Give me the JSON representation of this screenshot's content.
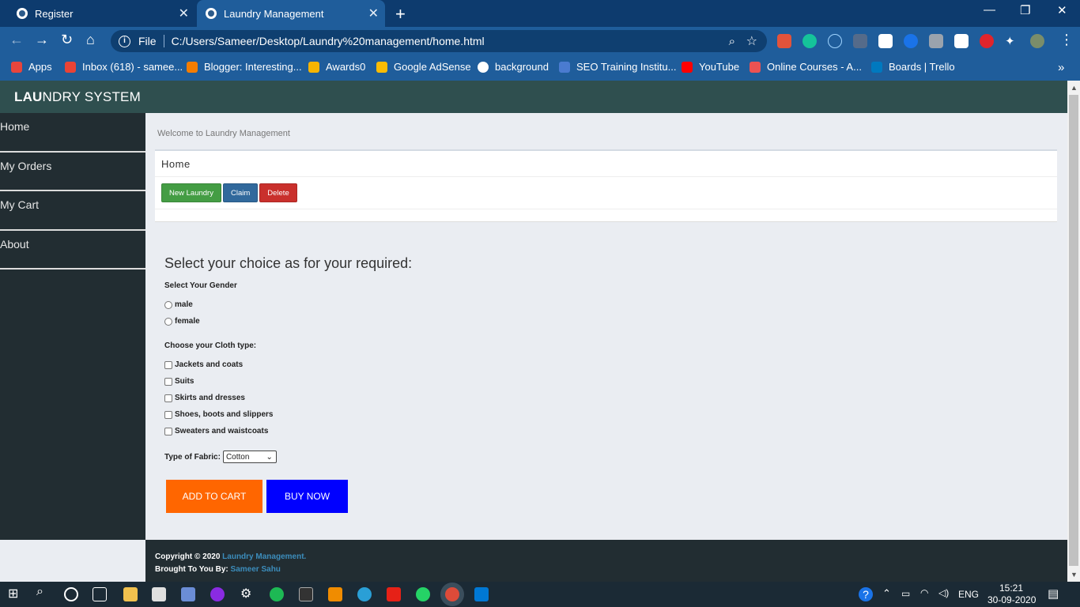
{
  "browser": {
    "tabs": [
      {
        "label": "Register",
        "active": false
      },
      {
        "label": "Laundry Management",
        "active": true
      }
    ],
    "new_tab_symbol": "+",
    "window_controls": [
      "minimize-icon",
      "restore-icon",
      "close-icon"
    ],
    "address": {
      "scheme_label": "File",
      "url": "C:/Users/Sameer/Desktop/Laundry%20management/home.html"
    },
    "bookmarks": [
      {
        "label": "Apps",
        "icon": "apps-grid-icon",
        "color": "#e8453c"
      },
      {
        "label": "Inbox (618) - samee...",
        "icon": "gmail-icon",
        "color": "#ea4335"
      },
      {
        "label": "Blogger: Interesting...",
        "icon": "blogger-icon",
        "color": "#f57d00"
      },
      {
        "label": "Awards0",
        "icon": "awards-icon",
        "color": "#f5b400"
      },
      {
        "label": "Google AdSense",
        "icon": "adsense-icon",
        "color": "#fbbc04"
      },
      {
        "label": "background",
        "icon": "globe-icon",
        "color": "#ffffff"
      },
      {
        "label": "SEO Training Institu...",
        "icon": "seo-icon",
        "color": "#4a7bd0"
      },
      {
        "label": "YouTube",
        "icon": "youtube-icon",
        "color": "#ff0000"
      },
      {
        "label": "Online Courses - A...",
        "icon": "udemy-icon",
        "color": "#ec5252"
      },
      {
        "label": "Boards | Trello",
        "icon": "trello-icon",
        "color": "#0079bf"
      }
    ],
    "bookmarks_overflow": "»"
  },
  "app": {
    "brand_bold": "LAU",
    "brand_rest": "NDRY SYSTEM",
    "sidebar": [
      "Home",
      "My Orders",
      "My Cart",
      "About"
    ],
    "welcome": "Welcome to Laundry Management",
    "panel_title": "Home",
    "actions": [
      "New Laundry",
      "Claim",
      "Delete"
    ],
    "form": {
      "heading": "Select your choice as for your required:",
      "gender_label": "Select Your Gender",
      "genders": [
        "male",
        "female"
      ],
      "cloth_label": "Choose your Cloth type:",
      "cloth_types": [
        "Jackets and coats",
        "Suits",
        "Skirts and dresses",
        "Shoes, boots and slippers",
        "Sweaters and waistcoats"
      ],
      "fabric_label": "Type of Fabric:",
      "fabric_selected": "Cotton",
      "add_to_cart": "ADD TO CART",
      "buy_now": "BUY NOW"
    },
    "footer": {
      "copyright_prefix": "Copyright © 2020",
      "copyright_link": "Laundry Management.",
      "credit_prefix": "Brought To You By:",
      "credit_link": "Sameer Sahu"
    },
    "colors": {
      "header": "#2f4f4f",
      "sidebar": "#222d32",
      "add_to_cart": "#ff6600",
      "buy_now": "#0000ff",
      "btn_new": "#449d44",
      "btn_claim": "#31699c",
      "btn_delete": "#c9302c"
    }
  },
  "taskbar": {
    "language": "ENG",
    "time": "15:21",
    "date": "30-09-2020"
  }
}
